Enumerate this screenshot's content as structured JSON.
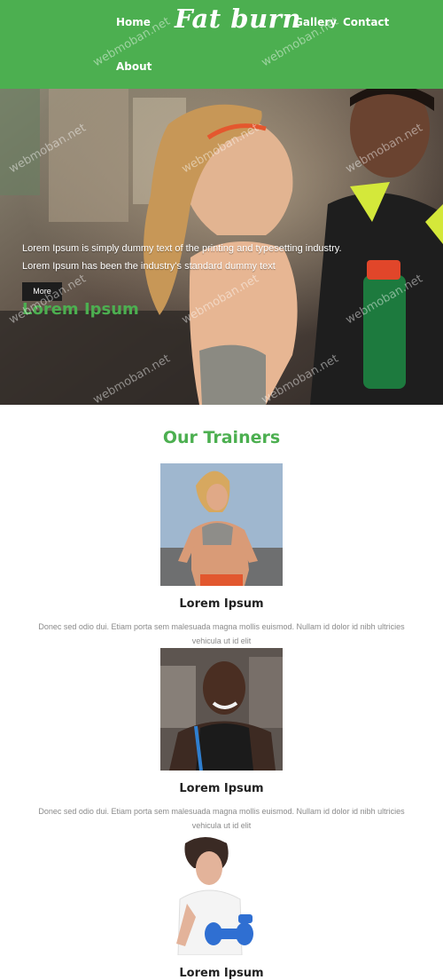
{
  "brand": {
    "logo_text": "Fat burn"
  },
  "nav": {
    "home": "Home",
    "gallery": "Gallery",
    "contact": "Contact",
    "about": "About"
  },
  "hero": {
    "title": "Lorem Ipsum",
    "line1": "Lorem Ipsum is simply dummy text of the printing and typesetting industry.",
    "line2": "Lorem Ipsum has been the industry's standard dummy text",
    "button": "More"
  },
  "trainers": {
    "heading": "Our Trainers",
    "items": [
      {
        "name": "Lorem Ipsum",
        "desc_line1": "Donec sed odio dui. Etiam porta sem malesuada magna mollis euismod. Nullam id dolor id nibh ultricies",
        "desc_line2": "vehicula ut id elit"
      },
      {
        "name": "Lorem Ipsum",
        "desc_line1": "Donec sed odio dui. Etiam porta sem malesuada magna mollis euismod. Nullam id dolor id nibh ultricies",
        "desc_line2": "vehicula ut id elit"
      },
      {
        "name": "Lorem Ipsum"
      }
    ]
  },
  "watermark_text": "webmoban.net",
  "colors": {
    "accent": "#4caf50",
    "button_bg": "#1d1d1d",
    "text_muted": "#8a8a8a"
  }
}
